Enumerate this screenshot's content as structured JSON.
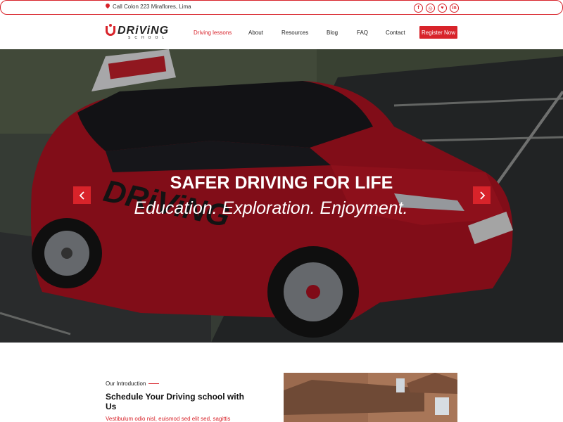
{
  "topbar": {
    "address": "Call Colon 223 Miraflores, Lima",
    "social": [
      "f",
      "ig",
      "tw",
      "in"
    ]
  },
  "logo": {
    "word": "DRiViNG",
    "sub": "SCHOOL"
  },
  "nav": {
    "items": [
      "Driving lessons",
      "About",
      "Resources",
      "Blog",
      "FAQ",
      "Contact"
    ],
    "register": "Register Now"
  },
  "hero": {
    "title": "SAFER DRIVING FOR LIFE",
    "subtitle": "Education. Exploration. Enjoyment."
  },
  "intro": {
    "kicker": "Our Introduction",
    "title": "Schedule Your Driving school with Us",
    "text": "Vestibulum odio nisl, euismod sed elit sed, sagittis"
  },
  "colors": {
    "accent": "#d8232a"
  }
}
